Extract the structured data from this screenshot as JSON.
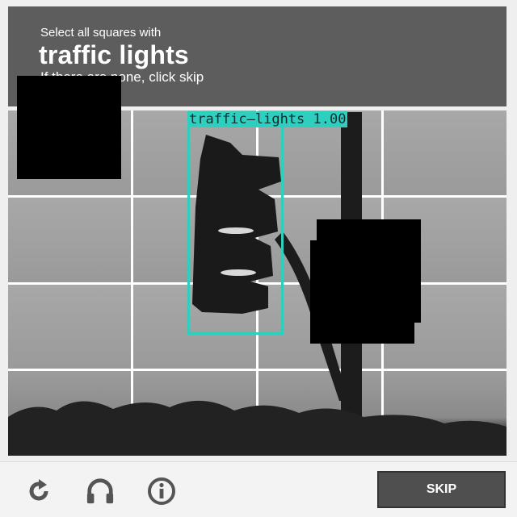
{
  "header": {
    "instruction": "Select all squares with",
    "target": "traffic lights",
    "hint": "If there are none, click skip"
  },
  "detection": {
    "label": "traffic–lights 1.00",
    "color": "#2fcfc0"
  },
  "footer": {
    "reload_icon": "reload-icon",
    "audio_icon": "headphones-icon",
    "info_icon": "info-icon",
    "skip_label": "SKIP"
  },
  "colors": {
    "header_bg": "#5d5d5d",
    "button_bg": "#4f4f4f"
  }
}
